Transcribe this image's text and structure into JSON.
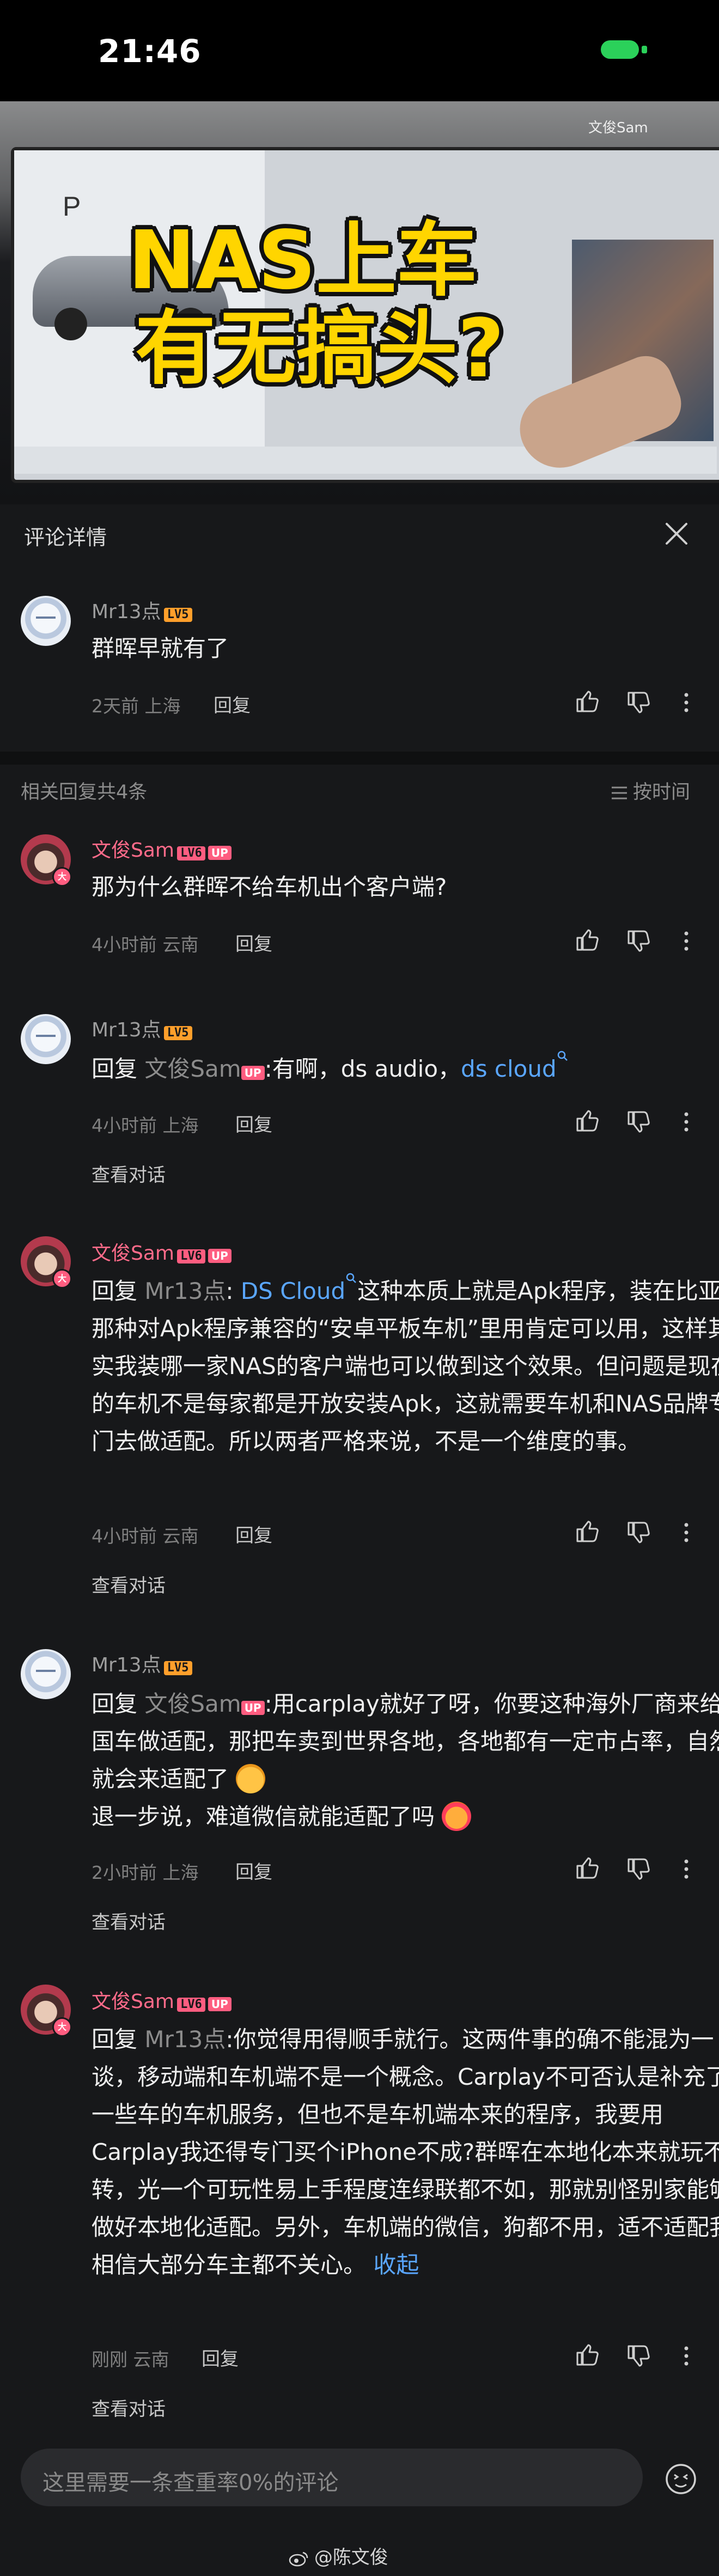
{
  "status_bar": {
    "time": "21:46"
  },
  "video": {
    "overlay_line1": "NAS上车",
    "overlay_line2": "有无搞头?",
    "watermark": "文俊Sam"
  },
  "panel": {
    "title": "评论详情"
  },
  "main_comment": {
    "author": "Mr13点",
    "level": "LV5",
    "text": "群晖早就有了",
    "meta": "2天前 上海",
    "reply_label": "回复"
  },
  "related": {
    "count_label": "相关回复共4条",
    "sort_label": "按时间"
  },
  "replies": [
    {
      "author": "文俊Sam",
      "level": "LV6",
      "up": "UP",
      "text": "那为什么群晖不给车机出个客户端?",
      "meta": "4小时前 云南",
      "reply_label": "回复"
    },
    {
      "author": "Mr13点",
      "level": "LV5",
      "prefix": "回复",
      "reply_to": "文俊Sam",
      "reply_to_up": "UP",
      "text": ":有啊，ds audio，",
      "link": "ds cloud",
      "meta": "4小时前 上海",
      "reply_label": "回复",
      "view_conversation": "查看对话"
    },
    {
      "author": "文俊Sam",
      "level": "LV6",
      "up": "UP",
      "prefix": "回复",
      "reply_to": "Mr13点",
      "colon": ":",
      "link": "DS Cloud",
      "text": "这种本质上就是Apk程序，装在比亚迪那种对Apk程序兼容的“安卓平板车机”里用肯定可以用，这样其实我装哪一家NAS的客户端也可以做到这个效果。但问题是现在的车机不是每家都是开放安装Apk，这就需要车机和NAS品牌专门去做适配。所以两者严格来说，不是一个维度的事。",
      "meta": "4小时前 云南",
      "reply_label": "回复",
      "view_conversation": "查看对话"
    },
    {
      "author": "Mr13点",
      "level": "LV5",
      "prefix": "回复",
      "reply_to": "文俊Sam",
      "reply_to_up": "UP",
      "text": ":用carplay就好了呀，你要这种海外厂商来给国车做适配，那把车卖到世界各地，各地都有一定市占率，自然就会来适配了",
      "text2": "退一步说，难道微信就能适配了吗",
      "meta": "2小时前 上海",
      "reply_label": "回复",
      "view_conversation": "查看对话"
    },
    {
      "author": "文俊Sam",
      "level": "LV6",
      "up": "UP",
      "prefix": "回复",
      "reply_to": "Mr13点",
      "text": ":你觉得用得顺手就行。这两件事的确不能混为一谈，移动端和车机端不是一个概念。Carplay不可否认是补充了一些车的车机服务，但也不是车机端本来的程序，我要用Carplay我还得专门买个iPhone不成?群晖在本地化本来就玩不转，光一个可玩性易上手程度连绿联都不如，那就别怪别家能够做好本地化适配。另外，车机端的微信，狗都不用，适不适配我相信大部分车主都不关心。",
      "collapse": "收起",
      "meta": "刚刚 云南",
      "reply_label": "回复",
      "view_conversation": "查看对话"
    }
  ],
  "input": {
    "placeholder": "这里需要一条查重率0%的评论"
  },
  "watermark": "@陈文俊",
  "icons": [
    "close-icon",
    "thumb-up-icon",
    "thumb-down-icon",
    "more-icon",
    "sort-icon",
    "emoji-icon",
    "search-icon",
    "weibo-icon"
  ]
}
